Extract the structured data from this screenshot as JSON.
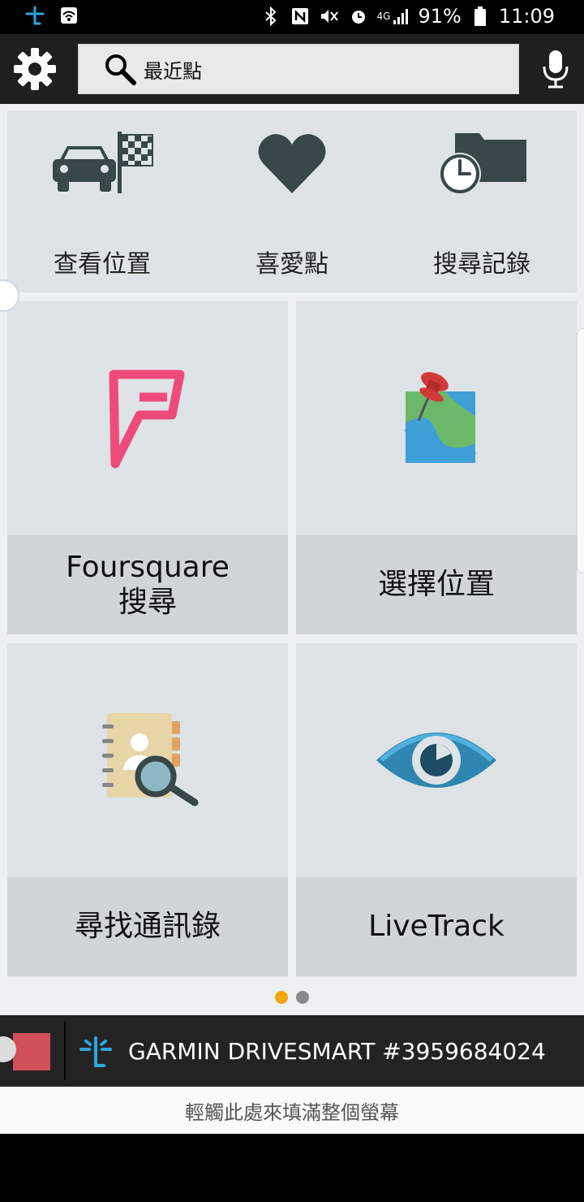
{
  "status_bar": {
    "battery": "91%",
    "time": "11:09",
    "network": "4G"
  },
  "toolbar": {
    "search_label": "最近點"
  },
  "quick_actions": [
    {
      "label": "查看位置",
      "icon": "car-flag-icon"
    },
    {
      "label": "喜愛點",
      "icon": "heart-icon"
    },
    {
      "label": "搜尋記錄",
      "icon": "clock-folder-icon"
    }
  ],
  "tiles": [
    {
      "label": "Foursquare\n搜尋",
      "icon": "foursquare-icon"
    },
    {
      "label": "選擇位置",
      "icon": "map-pin-icon"
    },
    {
      "label": "尋找通訊錄",
      "icon": "contacts-search-icon"
    },
    {
      "label": "LiveTrack",
      "icon": "eye-icon"
    }
  ],
  "pager": {
    "active": 0,
    "count": 2
  },
  "device": {
    "name": "GARMIN DRIVESMART #3959684024"
  },
  "fill_prompt": "輕觸此處來填滿整個螢幕",
  "colors": {
    "active_dot": "#f5a40c",
    "inactive_dot": "#8a8a8a",
    "stop_button": "#d24e58",
    "garmin_blue": "#2aa7dd"
  }
}
